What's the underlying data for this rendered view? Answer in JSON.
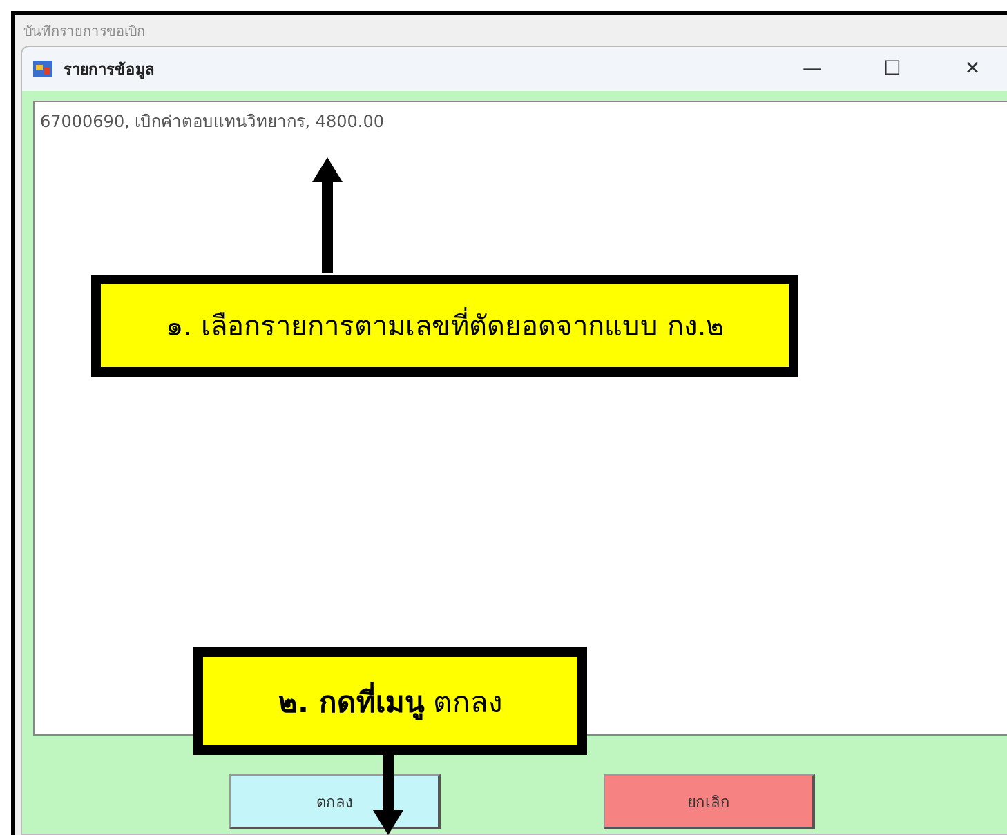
{
  "background_window": {
    "title": "บันทึกรายการขอเบิก"
  },
  "window": {
    "title": "รายการข้อมูล",
    "controls": [
      "—",
      "☐",
      "✕"
    ]
  },
  "list": {
    "items": [
      "67000690, เบิกค่าตอบแทนวิทยากร, 4800.00"
    ]
  },
  "buttons": [
    {
      "label": "ตกลง",
      "kind": "ok"
    },
    {
      "label": "ยกเลิก",
      "kind": "cancel"
    }
  ],
  "annotations": [
    {
      "text": "๑. เลือกรายการตามเลขที่ตัดยอดจากแบบ กง.๒",
      "kind": "up"
    },
    {
      "text": "**๒. กดที่เมนู** ตกลง",
      "kind": "down"
    }
  ]
}
